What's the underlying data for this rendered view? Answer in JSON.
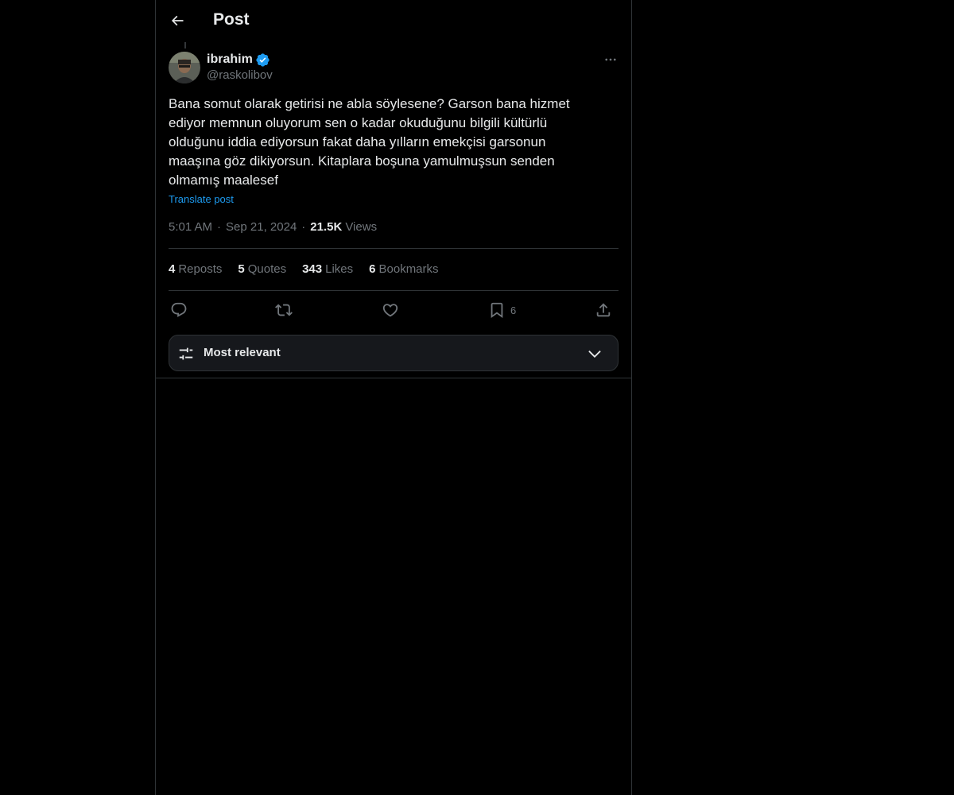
{
  "header": {
    "title": "Post"
  },
  "author": {
    "display_name": "ibrahim",
    "handle": "@raskolibov",
    "verified": true
  },
  "post": {
    "text": "Bana somut olarak getirisi ne abla söylesene? Garson bana hizmet\nediyor memnun oluyorum sen o kadar okuduğunu bilgili kültürlü\nolduğunu iddia ediyorsun fakat daha yılların emekçisi garsonun\nmaaşına göz dikiyorsun. Kitaplara boşuna yamulmuşsun senden\nolmamış maalesef",
    "translate_label": "Translate post",
    "time": "5:01 AM",
    "date": "Sep 21, 2024",
    "views_count": "21.5K",
    "views_label": "Views"
  },
  "stats": [
    {
      "count": "4",
      "label": "Reposts"
    },
    {
      "count": "5",
      "label": "Quotes"
    },
    {
      "count": "343",
      "label": "Likes"
    },
    {
      "count": "6",
      "label": "Bookmarks"
    }
  ],
  "actions": {
    "reply": {
      "icon": "reply-icon",
      "count": ""
    },
    "repost": {
      "icon": "repost-icon",
      "count": ""
    },
    "like": {
      "icon": "heart-icon",
      "count": ""
    },
    "bookmark": {
      "icon": "bookmark-icon",
      "count": "6"
    },
    "share": {
      "icon": "share-icon",
      "count": ""
    }
  },
  "sort": {
    "label": "Most relevant"
  },
  "colors": {
    "background": "#000000",
    "text": "#e7e9ea",
    "secondary": "#71767b",
    "accent": "#1d9bf0",
    "border": "#2f3336"
  }
}
